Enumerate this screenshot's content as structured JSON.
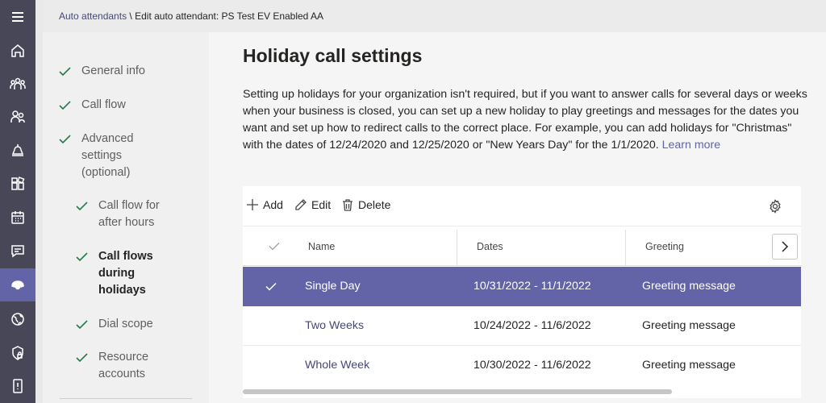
{
  "breadcrumb": {
    "parent": "Auto attendants",
    "separator": " \\ ",
    "current": "Edit auto attendant: PS Test EV Enabled AA"
  },
  "rail": {
    "items": [
      {
        "icon": "hamburger-menu-icon"
      },
      {
        "icon": "home-icon"
      },
      {
        "icon": "teams-icon"
      },
      {
        "icon": "users-icon"
      },
      {
        "icon": "meetings-icon"
      },
      {
        "icon": "apps-icon"
      },
      {
        "icon": "calendar-icon"
      },
      {
        "icon": "messaging-icon"
      },
      {
        "icon": "voice-icon",
        "active": true
      },
      {
        "icon": "locations-icon"
      },
      {
        "icon": "security-icon"
      },
      {
        "icon": "mobile-icon"
      }
    ]
  },
  "steps": [
    {
      "label": "General info"
    },
    {
      "label": "Call flow"
    },
    {
      "label": "Advanced settings (optional)"
    },
    {
      "label": "Call flow for after hours"
    },
    {
      "label": "Call flows during holidays",
      "current": true
    },
    {
      "label": "Dial scope"
    },
    {
      "label": "Resource accounts"
    }
  ],
  "main": {
    "title": "Holiday call settings",
    "description": "Setting up holidays for your organization isn't required, but if you want to answer calls for several days or weeks when your business is closed, you can set up a new holiday to play greetings and messages for the dates you want and set up how to redirect calls to the correct place. For example, you can add holidays for \"Christmas\" with the dates of 12/24/2020 and 12/25/2020 or \"New Years Day\" for the 1/1/2020.",
    "learn_more": "Learn more"
  },
  "toolbar": {
    "add_label": "Add",
    "edit_label": "Edit",
    "delete_label": "Delete"
  },
  "table": {
    "columns": [
      "Name",
      "Dates",
      "Greeting"
    ],
    "rows": [
      {
        "name": "Single Day",
        "dates": "10/31/2022 - 11/1/2022",
        "greeting": "Greeting message",
        "selected": true
      },
      {
        "name": "Two Weeks",
        "dates": "10/24/2022 - 11/6/2022",
        "greeting": "Greeting message"
      },
      {
        "name": "Whole Week",
        "dates": "10/30/2022 - 11/6/2022",
        "greeting": "Greeting message"
      }
    ]
  },
  "colors": {
    "accent": "#6264a7",
    "rail": "#484758",
    "check": "#237b4b"
  }
}
